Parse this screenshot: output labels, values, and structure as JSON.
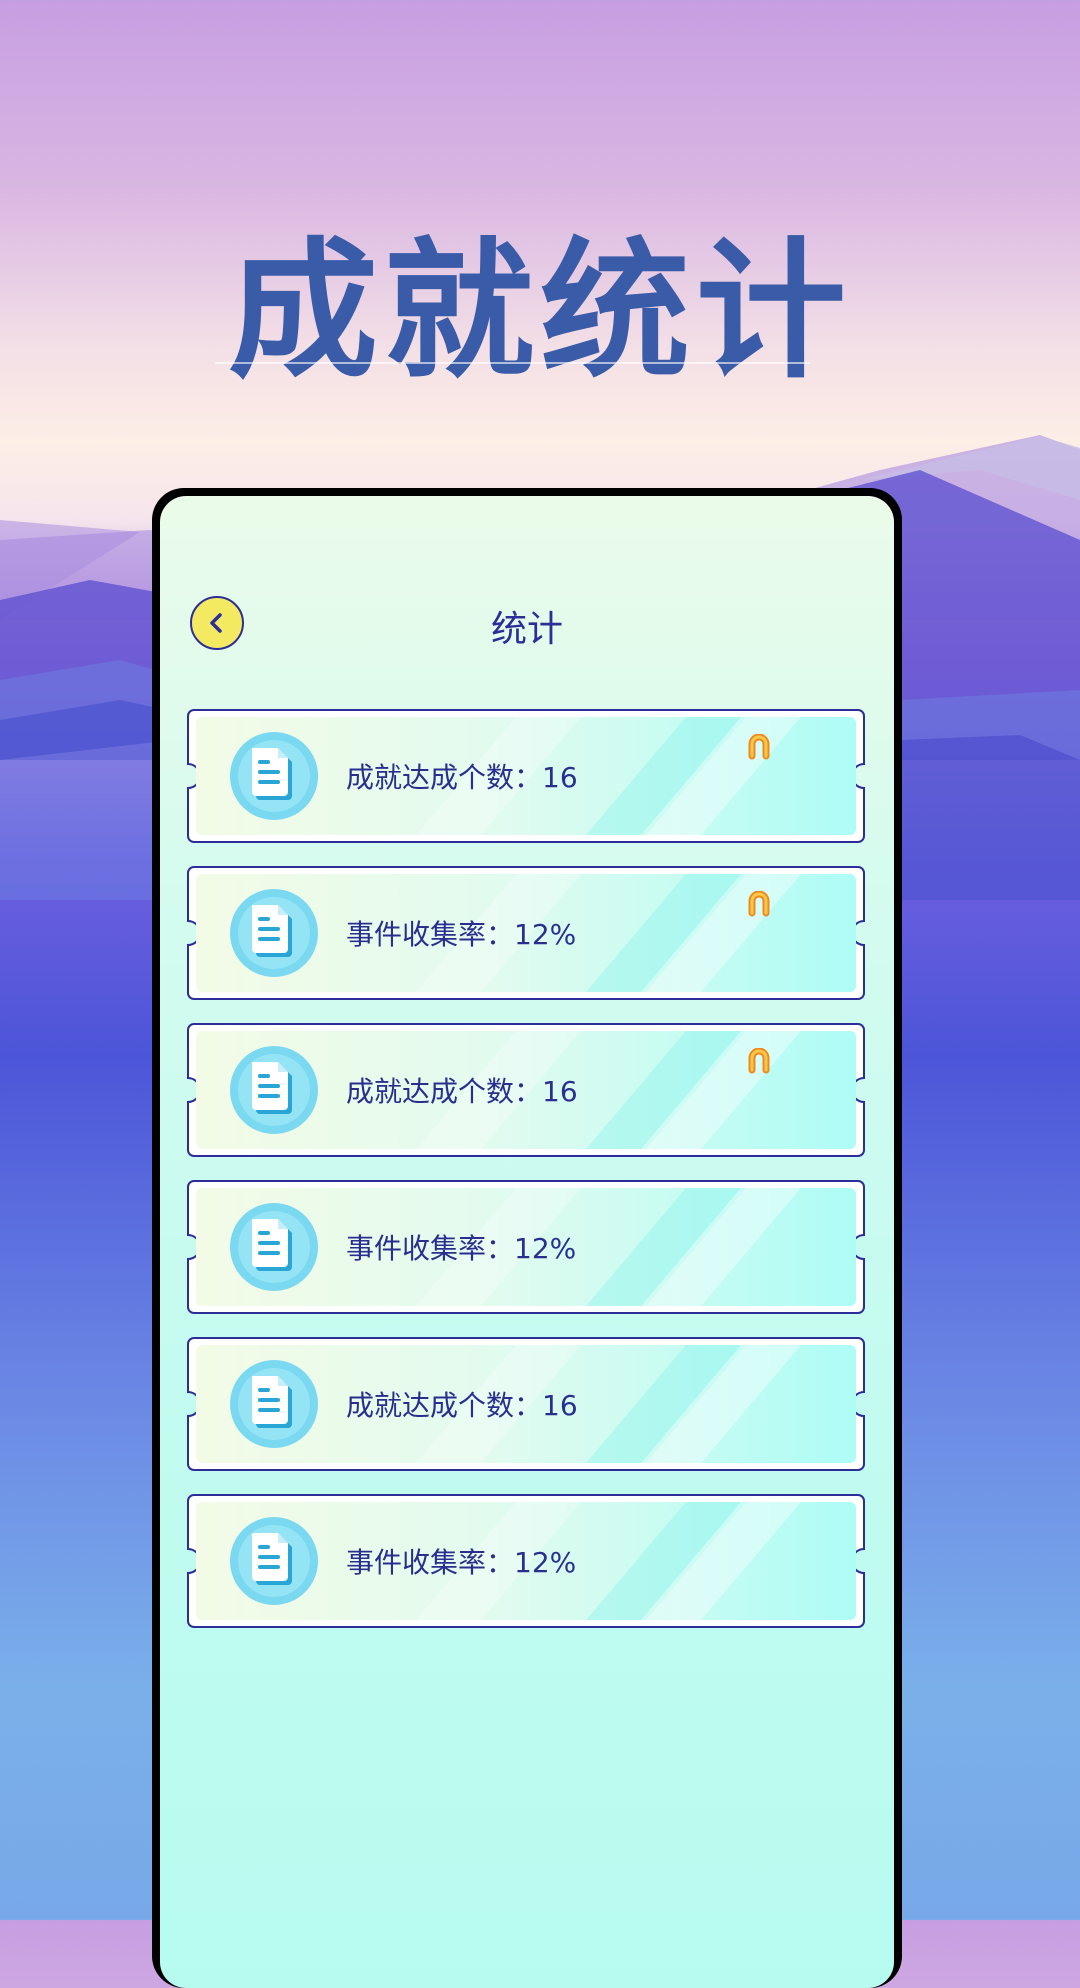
{
  "hero": {
    "title": "成就统计"
  },
  "screen": {
    "title": "统计",
    "back_icon": "chevron-left-icon"
  },
  "colors": {
    "accent": "#2d2d9a",
    "title": "#3a5ba8",
    "back_button": "#f4ea62",
    "badge": "#f08a1e"
  },
  "stats": [
    {
      "label": "成就达成个数：16",
      "icon": "document-icon",
      "badge": true
    },
    {
      "label": "事件收集率：12%",
      "icon": "document-icon",
      "badge": true
    },
    {
      "label": "成就达成个数：16",
      "icon": "document-icon",
      "badge": true
    },
    {
      "label": "事件收集率：12%",
      "icon": "document-icon",
      "badge": false
    },
    {
      "label": "成就达成个数：16",
      "icon": "document-icon",
      "badge": false
    },
    {
      "label": "事件收集率：12%",
      "icon": "document-icon",
      "badge": false
    }
  ]
}
